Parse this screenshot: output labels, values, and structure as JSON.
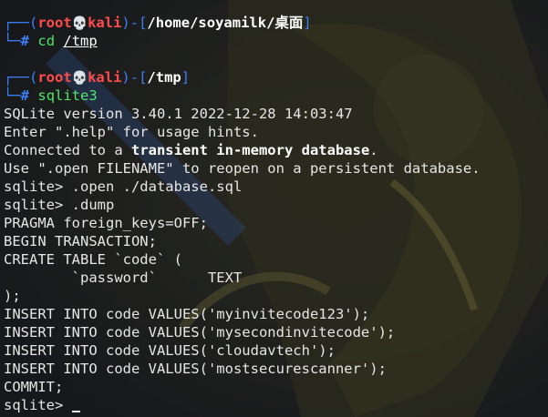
{
  "prompt1": {
    "user": "root",
    "skull": "💀",
    "host": "kali",
    "path": "/home/soyamilk/桌面",
    "command": "cd",
    "arg": "/tmp"
  },
  "prompt2": {
    "user": "root",
    "skull": "💀",
    "host": "kali",
    "path": "/tmp",
    "command": "sqlite3"
  },
  "output": {
    "version": "SQLite version 3.40.1 2022-12-28 14:03:47",
    "hint": "Enter \".help\" for usage hints.",
    "connected_prefix": "Connected to a ",
    "connected_bold": "transient in-memory database",
    "connected_suffix": ".",
    "use_open": "Use \".open FILENAME\" to reopen on a persistent database.",
    "cmd_open": "sqlite> .open ./database.sql",
    "cmd_dump": "sqlite> .dump",
    "pragma": "PRAGMA foreign_keys=OFF;",
    "begin": "BEGIN TRANSACTION;",
    "create": "CREATE TABLE `code` (",
    "column": "        `password`      TEXT",
    "close": ");",
    "insert1": "INSERT INTO code VALUES('myinvitecode123');",
    "insert2": "INSERT INTO code VALUES('mysecondinvitecode');",
    "insert3": "INSERT INTO code VALUES('cloudavtech');",
    "insert4": "INSERT INTO code VALUES('mostsecurescanner');",
    "commit": "COMMIT;",
    "final_prompt": "sqlite> "
  },
  "colors": {
    "background": "#1c1d22",
    "prompt_frame": "#3b7ff5",
    "user_host": "#ff4b4b",
    "command": "#4ee66a",
    "text": "#e6e6e6"
  }
}
